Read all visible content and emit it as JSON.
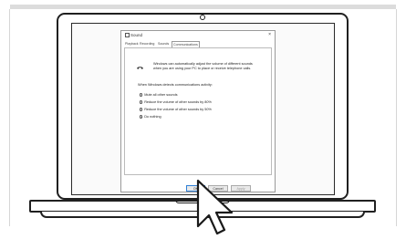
{
  "dialog": {
    "title": "Sound",
    "close_glyph": "×",
    "tabs": [
      "Playback",
      "Recording",
      "Sounds",
      "Communications"
    ],
    "active_tab": "Communications",
    "info_text": "Windows can automatically adjust the volume of different sounds when you are using your PC to place or receive telephone calls.",
    "question": "When Windows detects communications activity:",
    "options": [
      {
        "label": "Mute all other sounds",
        "selected": false
      },
      {
        "label": "Reduce the volume of other sounds by 80%",
        "selected": false
      },
      {
        "label": "Reduce the volume of other sounds by 50%",
        "selected": false
      },
      {
        "label": "Do nothing",
        "selected": true
      }
    ],
    "buttons": {
      "ok": "OK",
      "cancel": "Cancel",
      "apply": "Apply"
    }
  },
  "icons": {
    "phone": "telephone-icon",
    "cursor": "mouse-pointer-icon",
    "camera": "webcam-icon"
  },
  "colors": {
    "outline": "#202020",
    "focus": "#2f7fd6",
    "background": "#ffffff"
  }
}
